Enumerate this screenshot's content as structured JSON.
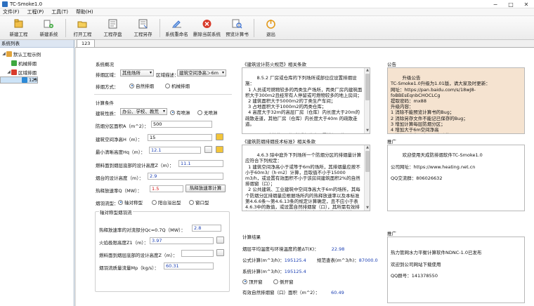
{
  "window": {
    "title": "TC-Smoke1.0"
  },
  "menu": [
    "文件(F)",
    "工程(P)",
    "工具(T)",
    "帮助(H)"
  ],
  "toolbar": [
    {
      "label": "新建工程",
      "icon": "new-project-icon"
    },
    {
      "label": "新建系统",
      "icon": "new-system-icon"
    },
    {
      "label": "打开工程",
      "icon": "open-project-icon"
    },
    {
      "label": "工程存盘",
      "icon": "save-project-icon"
    },
    {
      "label": "工程另存",
      "icon": "save-as-icon"
    },
    {
      "label": "系统重命名",
      "icon": "rename-system-icon"
    },
    {
      "label": "删除当前系统",
      "icon": "delete-system-icon"
    },
    {
      "label": "预览计算书",
      "icon": "preview-report-icon"
    },
    {
      "label": "退出",
      "icon": "exit-icon"
    }
  ],
  "sidebar": {
    "header": "系统列表",
    "tree": [
      {
        "label": "默认工程示例",
        "level": 0
      },
      {
        "label": "机械排烟",
        "level": 1
      },
      {
        "label": "区域排烟",
        "level": 1
      },
      {
        "label": "123",
        "level": 2
      }
    ]
  },
  "tab": {
    "label": "123"
  },
  "overview": {
    "title": "系统概况",
    "zone_label": "排烟区域：",
    "zone_value": "其他场所",
    "area_desc_label": "区域描述：",
    "area_desc_value": "建筑空间净高＞6m",
    "mode_label": "排烟方式：",
    "mode_options": [
      "自然排烟",
      "机械排烟"
    ]
  },
  "calc": {
    "title": "计算条件",
    "building_label": "建筑性质：",
    "building_value": "办公、学校、教荒",
    "sprinkler_options": [
      "有喷淋",
      "无喷淋"
    ],
    "area_label": "防烟分区面积A（m^2）：",
    "area_value": "500",
    "height_label": "建筑空间净高H（m）：",
    "height_value": "15",
    "min_clear_label": "最小清晰高度Hq（m）：",
    "min_clear_value": "12.1",
    "smoke_layer_label": "燃料面到烟层底部的设计高度Z（m）：",
    "smoke_layer_value": "11.1",
    "design_height_label": "烟台的设计高度（m）：",
    "design_height_value": "2.9",
    "heat_release_label": "热释放速率Q（MW）：",
    "heat_release_value": "1.5",
    "heat_calc_button": "热释放速率计算",
    "plume_type_label": "烟羽流型：",
    "plume_options": [
      "轴对称型",
      "阳台溢出型",
      "窗口型"
    ],
    "plume_group_title": "轴对称型烟羽流",
    "convective_label": "热释放速率的对流部分Qc=0.7Q（MW）：",
    "convective_value": "2.8",
    "flame_limit_label": "火焰极限高度Z1（m）：",
    "flame_limit_value": "3.97",
    "fuel_height_label": "燃料面到烟层底部的设计高度Z（m）：",
    "fuel_height_value": "",
    "mass_flow_label": "烟羽流质量流量Mp（kg/s）：",
    "mass_flow_value": "60.31"
  },
  "code1": {
    "title": "《建筑设计防火规范》相关条款",
    "text": "8.5.2 厂房或仓库的下列场所或部位应设置排烟设施：\n  1 人员或可燃物较多的丙类生产场所，丙类厂房内建筑面积大于300m2且经常有人停留或可燃物较多的地上房间；\n  2 建筑面积大于5000m2的丁类生产车间；\n  3 占地面积大于1000m2的丙类仓库；\n  4 高度大于32m的高层厂房（仓库）内长度大于20m的疏散走道，其他厂房（仓库）内长度大于40m 的疏散走道。\n\n8.5.3 民用建筑的下列场所或部位应设置排烟设施："
  },
  "code2": {
    "title": "《建筑防烟排烟技术标准》相关条款",
    "text": "4.6.3 除中庭外下列场所一个防烟分区的排烟量计算应符合下列规定：\n  1 建筑空间净高小于或等于6m的场所，其排烟量应按不小于60m3/（h·m2）计算，且取值不小于15000 m3/h，或设置有效面积不小于该房间建筑面积2%的自然排烟窗（口）；\n  2 公共建筑、工业建筑中空间净高大于6m的场所，其每个防烟分区排烟量应根据场所内的热释放速率以及本标准第4.6.6条～第4.6.13条的规定计算确定，且不应小于表4.6.3中的数值，或设置自然排烟窗（口），其所需有效排烟面积应根据表4.6.3及自然排烟窗（口）处风速计算。"
  },
  "results": {
    "title": "计算结果",
    "temp_label": "烟层平均温度与环境温度的差ΔT(K)：",
    "temp_value": "22.98",
    "formula_label": "公式计算(m^3/h)：",
    "formula_value": "195125.4",
    "spec_label": "规范查表(m^3/h)：",
    "spec_value": "87000.0",
    "system_label": "系统计算(m^3/h)：",
    "system_value": "195125.4",
    "open_options": [
      "顶开窗",
      "侧开窗"
    ],
    "window_area_label": "有效自然排烟窗（口）面积（m^2）：",
    "window_area_value": "60.49"
  },
  "notice": {
    "title": "公告",
    "text": "升级公告\nTC-Smoke1.0升级为1.01版，请大家及时更新：\n网址：https://pan.baidu.com/s/18wJ8-foBBEsEqnbCHOCLCg\n提取密码：mx88\n升级内容：\n1 消除不能预览计算书的Bug；\n2 消除另存文件不能记已保存的Bug；\n3 增加计算每层防烟分区；\n4 增加大于6m空间净高\n5 增加用户名、密码已忘功能。"
  },
  "promo": {
    "title": "推广",
    "text": "欢迎使用天成防排烟软件TC-Smoke1.0\n\n公司网址：https://www.heating.net.cn\n\nQQ交流群：806026632"
  },
  "promo2": {
    "title": "推广",
    "text": "\n热力管网水力平衡计算软件NDNC-1.0已发布\n\n欢迎到公司网站下载使用\n\nQQ群号：141378550"
  },
  "colors": {
    "notice_bg": "#f5e3d0",
    "accent": "#1b3fb3",
    "warning_red": "#d01010"
  }
}
